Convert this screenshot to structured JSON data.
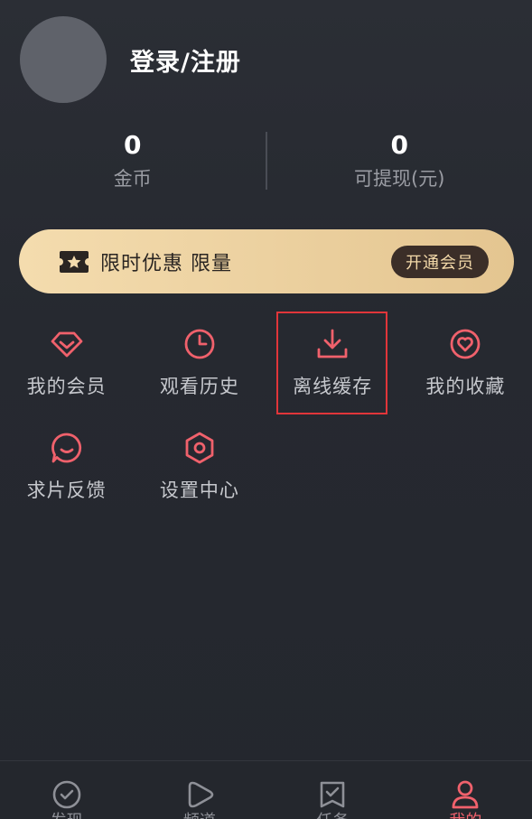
{
  "profile": {
    "login_label": "登录/注册"
  },
  "stats": [
    {
      "value": "0",
      "label": "金币"
    },
    {
      "value": "0",
      "label": "可提现(元)"
    }
  ],
  "promo": {
    "text": "限时优惠 限量",
    "button": "开通会员",
    "icon": "ticket-star-icon"
  },
  "menu": [
    {
      "label": "我的会员",
      "icon": "diamond-icon"
    },
    {
      "label": "观看历史",
      "icon": "clock-icon"
    },
    {
      "label": "离线缓存",
      "icon": "download-icon"
    },
    {
      "label": "我的收藏",
      "icon": "heart-icon"
    },
    {
      "label": "求片反馈",
      "icon": "chat-smile-icon"
    },
    {
      "label": "设置中心",
      "icon": "settings-icon"
    }
  ],
  "bottom_nav": [
    {
      "label": "发现",
      "icon": "compass-icon",
      "active": false
    },
    {
      "label": "频道",
      "icon": "play-icon",
      "active": false
    },
    {
      "label": "任务",
      "icon": "task-icon",
      "active": false
    },
    {
      "label": "我的",
      "icon": "user-icon",
      "active": true
    }
  ],
  "colors": {
    "accent": "#f0616c",
    "background": "#262930",
    "promo_gold": "#f4dcae",
    "highlight": "#e1353a"
  }
}
